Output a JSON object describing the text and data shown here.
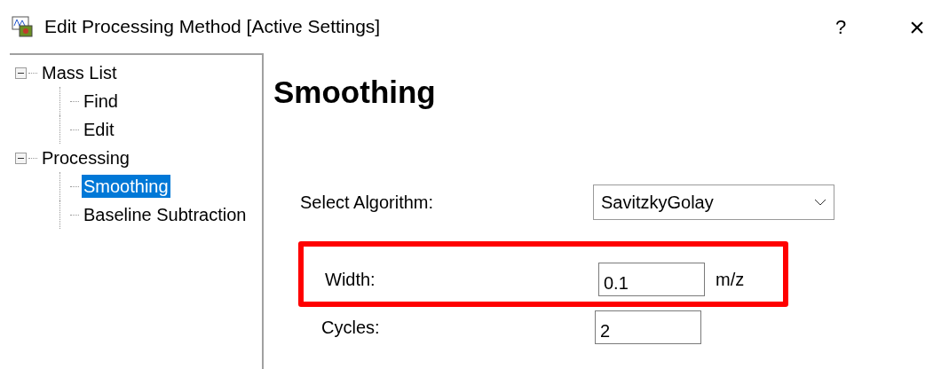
{
  "window": {
    "title": "Edit Processing Method [Active Settings]",
    "help": "?",
    "close": "×"
  },
  "tree": [
    {
      "label": "Mass List",
      "expanded": true,
      "selected": false,
      "children": [
        {
          "label": "Find",
          "selected": false
        },
        {
          "label": "Edit",
          "selected": false
        }
      ]
    },
    {
      "label": "Processing",
      "expanded": true,
      "selected": false,
      "children": [
        {
          "label": "Smoothing",
          "selected": true
        },
        {
          "label": "Baseline Subtraction",
          "selected": false
        }
      ]
    }
  ],
  "heading": "Smoothing",
  "algorithm": {
    "label": "Select Algorithm:",
    "value": "SavitzkyGolay"
  },
  "fields": [
    {
      "label": "Width:",
      "value": "0.1",
      "unit": "m/z",
      "highlighted": true
    },
    {
      "label": "Cycles:",
      "value": "2",
      "highlighted": false
    }
  ]
}
